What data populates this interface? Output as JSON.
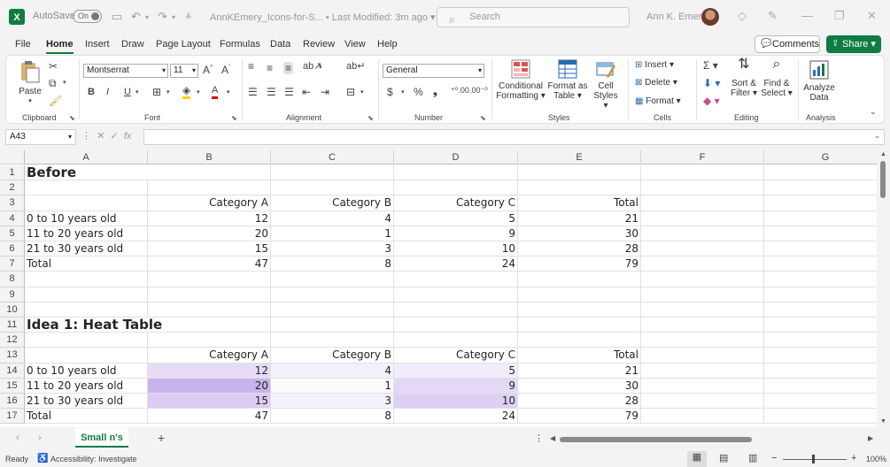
{
  "titlebar": {
    "autosave_label": "AutoSave",
    "autosave_state": "On",
    "doc_name": "AnnKEmery_Icons-for-S...",
    "modified": "• Last Modified: 3m ago",
    "search_placeholder": "Search",
    "user_name": "Ann K. Emery"
  },
  "menu": {
    "items": [
      "File",
      "Home",
      "Insert",
      "Draw",
      "Page Layout",
      "Formulas",
      "Data",
      "Review",
      "View",
      "Help"
    ],
    "comments": "Comments",
    "share": "Share"
  },
  "ribbon": {
    "paste": "Paste",
    "font_name": "Montserrat",
    "font_size": "11",
    "number_format": "General",
    "conditional": [
      "Conditional",
      "Formatting"
    ],
    "format_table": [
      "Format as",
      "Table"
    ],
    "cell_styles": [
      "Cell",
      "Styles"
    ],
    "insert": "Insert",
    "delete": "Delete",
    "format": "Format",
    "sort_filter": [
      "Sort &",
      "Filter"
    ],
    "find_select": [
      "Find &",
      "Select"
    ],
    "analyze": [
      "Analyze",
      "Data"
    ],
    "groups": {
      "clipboard": "Clipboard",
      "font": "Font",
      "alignment": "Alignment",
      "number": "Number",
      "styles": "Styles",
      "cells": "Cells",
      "editing": "Editing",
      "analysis": "Analysis"
    }
  },
  "formula_bar": {
    "name_box": "A43",
    "formula": ""
  },
  "columns": [
    "A",
    "B",
    "C",
    "D",
    "E",
    "F",
    "G"
  ],
  "rows": [
    {
      "n": "1",
      "a": "Before",
      "b": "",
      "c": "",
      "d": "",
      "e": "",
      "title": true
    },
    {
      "n": "2",
      "a": "",
      "b": "",
      "c": "",
      "d": "",
      "e": ""
    },
    {
      "n": "3",
      "a": "",
      "b": "Category A",
      "c": "Category B",
      "d": "Category C",
      "e": "Total"
    },
    {
      "n": "4",
      "a": "0 to 10 years old",
      "b": "12",
      "c": "4",
      "d": "5",
      "e": "21"
    },
    {
      "n": "5",
      "a": "11 to 20 years old",
      "b": "20",
      "c": "1",
      "d": "9",
      "e": "30"
    },
    {
      "n": "6",
      "a": "21 to 30 years old",
      "b": "15",
      "c": "3",
      "d": "10",
      "e": "28"
    },
    {
      "n": "7",
      "a": "Total",
      "b": "47",
      "c": "8",
      "d": "24",
      "e": "79"
    },
    {
      "n": "8",
      "a": "",
      "b": "",
      "c": "",
      "d": "",
      "e": ""
    },
    {
      "n": "9",
      "a": "",
      "b": "",
      "c": "",
      "d": "",
      "e": ""
    },
    {
      "n": "10",
      "a": "",
      "b": "",
      "c": "",
      "d": "",
      "e": ""
    },
    {
      "n": "11",
      "a": "Idea 1: Heat Table",
      "b": "",
      "c": "",
      "d": "",
      "e": "",
      "title": true
    },
    {
      "n": "12",
      "a": "",
      "b": "",
      "c": "",
      "d": "",
      "e": ""
    },
    {
      "n": "13",
      "a": "",
      "b": "Category A",
      "c": "Category B",
      "d": "Category C",
      "e": "Total"
    },
    {
      "n": "14",
      "a": "0 to 10 years old",
      "b": "12",
      "c": "4",
      "d": "5",
      "e": "21",
      "heat": [
        "#e6dcf7",
        "#f3effb",
        "#f1ecfb"
      ]
    },
    {
      "n": "15",
      "a": "11 to 20 years old",
      "b": "20",
      "c": "1",
      "d": "9",
      "e": "30",
      "heat": [
        "#c8b3ee",
        "#fbfafd",
        "#e3d8f6"
      ]
    },
    {
      "n": "16",
      "a": "21 to 30 years old",
      "b": "15",
      "c": "3",
      "d": "10",
      "e": "28",
      "heat": [
        "#dcccf3",
        "#f5f1fc",
        "#ddd0f4"
      ]
    },
    {
      "n": "17",
      "a": "Total",
      "b": "47",
      "c": "8",
      "d": "24",
      "e": "79"
    }
  ],
  "sheet": {
    "tab": "Small n's"
  },
  "status": {
    "ready": "Ready",
    "accessibility": "Accessibility: Investigate",
    "zoom": "100%"
  },
  "colors": {
    "accent": "#107c41"
  }
}
